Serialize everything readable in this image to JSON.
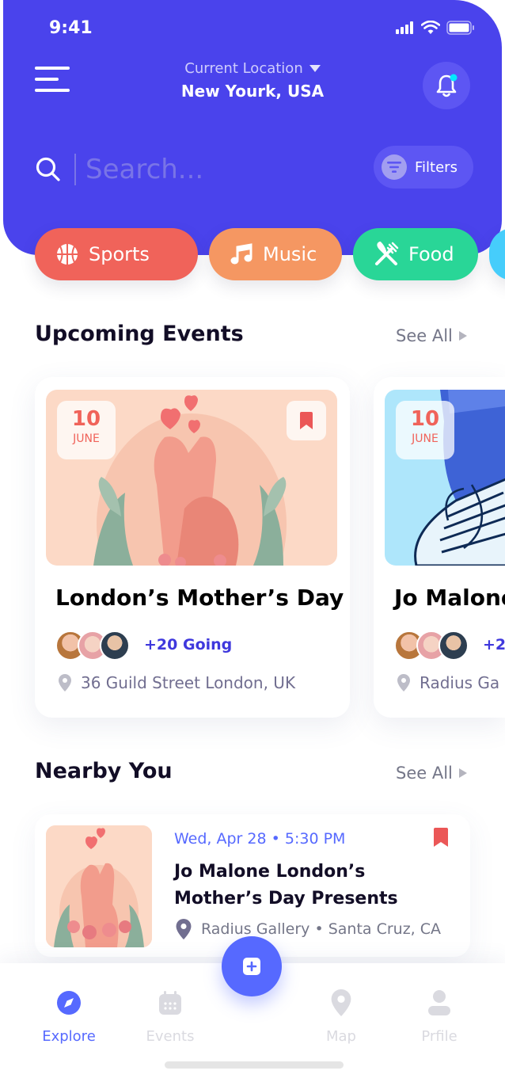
{
  "status_bar": {
    "time": "9:41"
  },
  "header": {
    "location_label": "Current Location",
    "location_value": "New Yourk, USA",
    "search_placeholder": "Search...",
    "filters_label": "Filters"
  },
  "categories": [
    {
      "label": "Sports",
      "icon": "basketball-icon",
      "color": "#F0635A"
    },
    {
      "label": "Music",
      "icon": "music-note-icon",
      "color": "#F59762"
    },
    {
      "label": "Food",
      "icon": "fork-knife-icon",
      "color": "#29D697"
    },
    {
      "label": "",
      "icon": "",
      "color": "#46CDFB"
    }
  ],
  "upcoming": {
    "title": "Upcoming Events",
    "see_all": "See All",
    "events": [
      {
        "day": "10",
        "month": "JUNE",
        "title": "London’s Mother’s Day",
        "going": "+20 Going",
        "address": "36 Guild Street London, UK"
      },
      {
        "day": "10",
        "month": "JUNE",
        "title": "Jo Malone",
        "going": "+2",
        "address": "Radius Ga"
      }
    ]
  },
  "nearby": {
    "title": "Nearby You",
    "see_all": "See All",
    "items": [
      {
        "date": "Wed, Apr 28 • 5:30 PM",
        "title": "Jo Malone London’s Mother’s Day Presents",
        "address": "Radius Gallery • Santa Cruz, CA"
      }
    ]
  },
  "bottom_nav": {
    "items": [
      {
        "label": "Explore",
        "icon": "compass-icon",
        "active": true
      },
      {
        "label": "Events",
        "icon": "calendar-icon",
        "active": false
      },
      {
        "label": "Map",
        "icon": "map-pin-icon",
        "active": false
      },
      {
        "label": "Prfile",
        "icon": "user-icon",
        "active": false
      }
    ]
  },
  "colors": {
    "primary": "#4A43EC",
    "accent": "#5669FF",
    "red": "#F0635A"
  }
}
